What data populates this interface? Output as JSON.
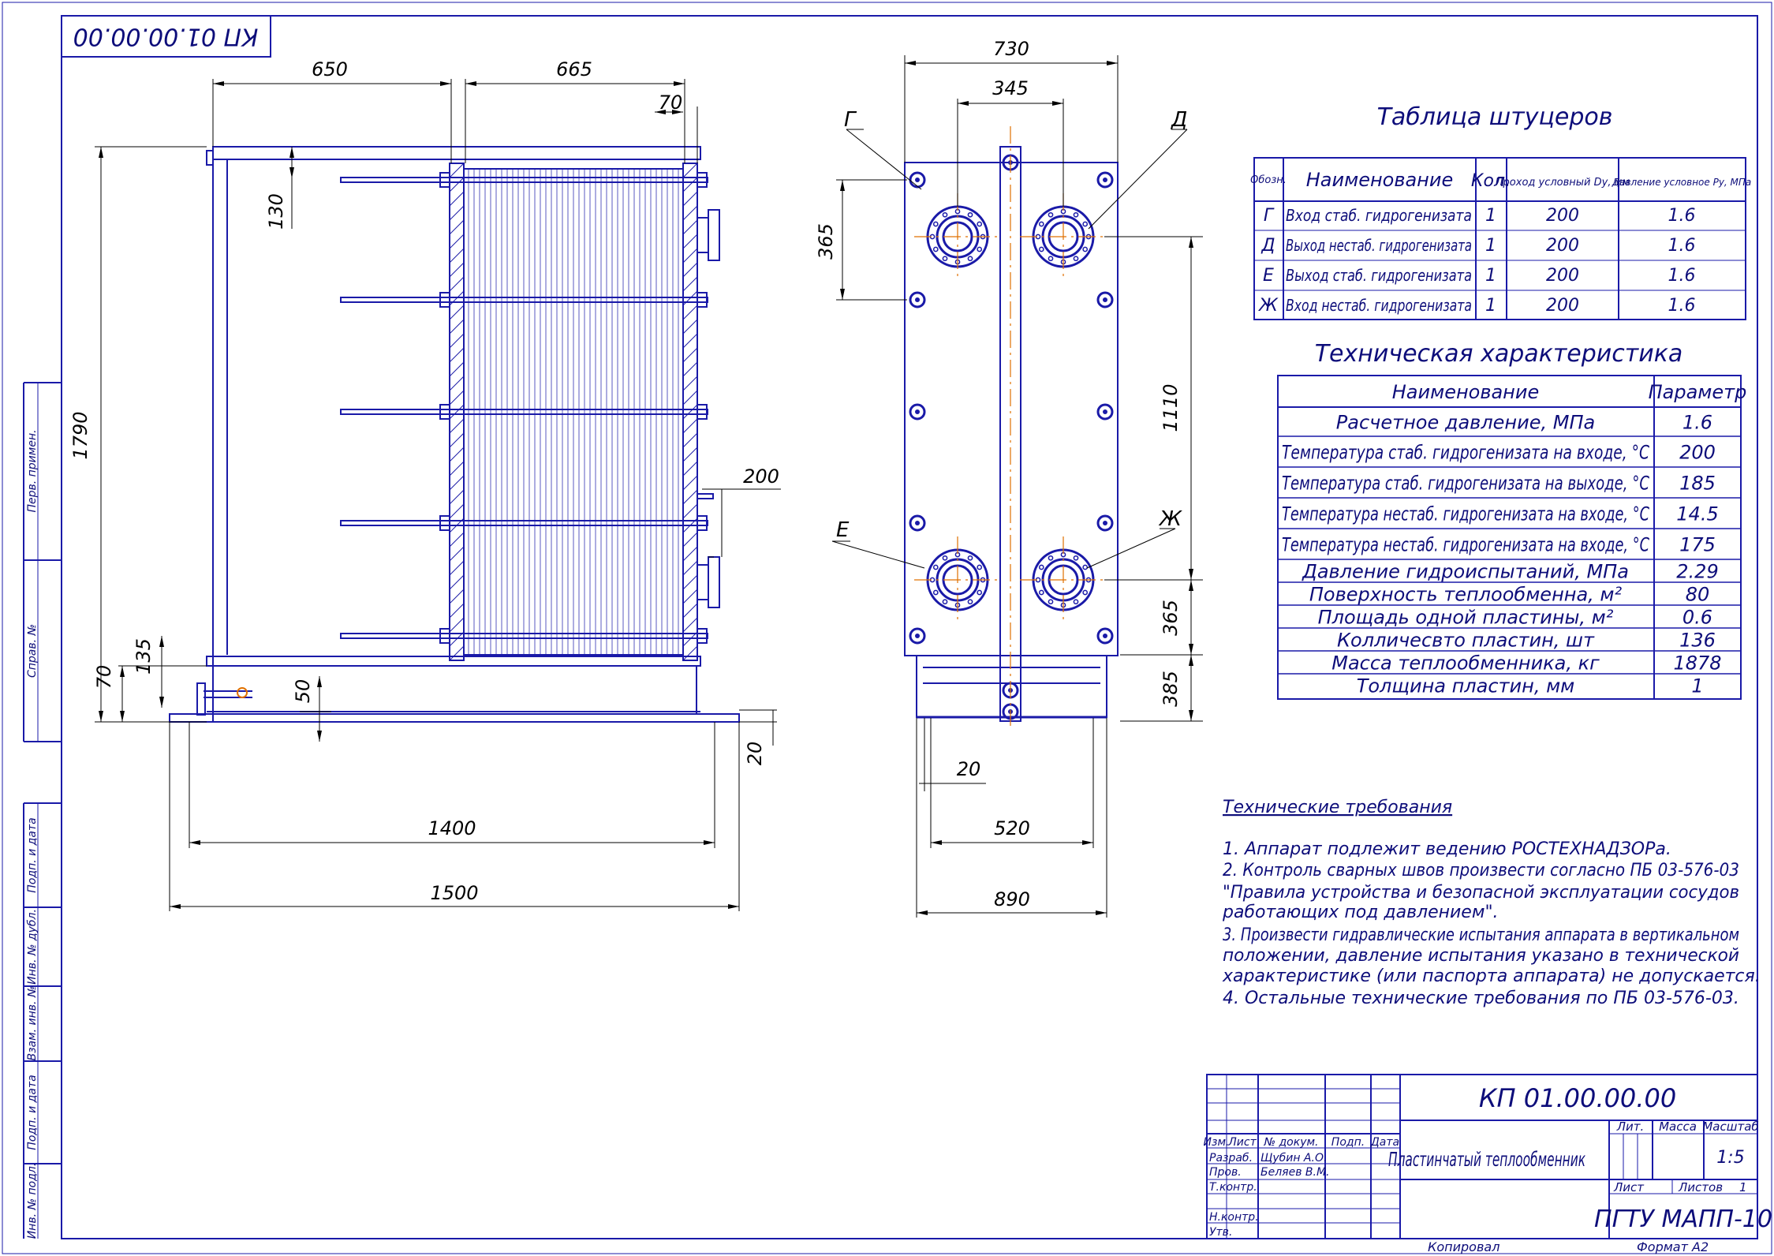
{
  "designation_stamp": "КП 01.00.00.00",
  "side_strip": [
    "Перв. примен.",
    "Справ. №",
    "Подп. и дата",
    "Инв. № дубл.",
    "Взам. инв. №",
    "Подп. и дата",
    "Инв. № подл."
  ],
  "dimensions": {
    "side_view": [
      "650",
      "665",
      "70",
      "130",
      "1790",
      "200",
      "135",
      "70",
      "50",
      "20",
      "1400",
      "1500"
    ],
    "front_view": [
      "730",
      "345",
      "365",
      "1110",
      "365",
      "385",
      "20",
      "520",
      "890"
    ]
  },
  "nozzle_letters": [
    "Г",
    "Д",
    "Е",
    "Ж"
  ],
  "nozzle_table": {
    "title": "Таблица штуцеров",
    "headers": [
      "Обозн.",
      "Наименование",
      "Кол.",
      "Проход условный Dу, мм",
      "Давление условное Pу, МПа"
    ],
    "rows": [
      [
        "Г",
        "Вход стаб. гидрогенизата",
        "1",
        "200",
        "1.6"
      ],
      [
        "Д",
        "Выход нестаб. гидрогенизата",
        "1",
        "200",
        "1.6"
      ],
      [
        "Е",
        "Выход стаб. гидрогенизата",
        "1",
        "200",
        "1.6"
      ],
      [
        "Ж",
        "Вход нестаб. гидрогенизата",
        "1",
        "200",
        "1.6"
      ]
    ]
  },
  "tech_table": {
    "title": "Техническая характеристика",
    "headers": [
      "Наименование",
      "Параметр"
    ],
    "rows": [
      [
        "Расчетное давление, МПа",
        "1.6"
      ],
      [
        "Температура стаб. гидрогенизата на входе, °С",
        "200"
      ],
      [
        "Температура стаб. гидрогенизата на выходе, °С",
        "185"
      ],
      [
        "Температура нестаб. гидрогенизата на входе, °С",
        "14.5"
      ],
      [
        "Температура нестаб. гидрогенизата на входе, °С",
        "175"
      ],
      [
        "Давление гидроиспытаний, МПа",
        "2.29"
      ],
      [
        "Поверхность теплообменна, м²",
        "80"
      ],
      [
        "Площадь одной пластины, м²",
        "0.6"
      ],
      [
        "Колличесвто пластин, шт",
        "136"
      ],
      [
        "Масса теплообменника, кг",
        "1878"
      ],
      [
        "Толщина пластин, мм",
        "1"
      ]
    ]
  },
  "requirements": {
    "title": "Технические требования",
    "lines": [
      "1. Аппарат подлежит ведению РОСТЕХНАДЗОРа.",
      "2. Контроль сварных швов произвести согласно ПБ 03-576-03",
      "\"Правила устройства и безопасной эксплуатации сосудов",
      "работающих под давлением\".",
      "3. Произвести гидравлические испытания аппарата в вертикальном",
      "положении, давление испытания указано в технической",
      "характеристике (или паспорта аппарата) не допускается.",
      "4. Остальные технические требования по ПБ 03-576-03."
    ]
  },
  "title_block": {
    "designation": "КП 01.00.00.00",
    "name": "Пластинчатый теплообменник",
    "col_headers": [
      "Изм.",
      "Лист",
      "№ докум.",
      "Подп.",
      "Дата"
    ],
    "row_labels": [
      "Разраб.",
      "Пров.",
      "Т.контр.",
      "Н.контр.",
      "Утв."
    ],
    "developer": "Щубин А.О.",
    "checker": "Беляев В.М.",
    "lit_label": "Лит.",
    "mass_label": "Масса",
    "scale_label": "Масштаб",
    "scale": "1:5",
    "sheet_label": "Лист",
    "sheets_label": "Листов",
    "sheets": "1",
    "org": "ПГТУ МАПП-10",
    "copied": "Копировал",
    "format": "Формат А2"
  }
}
